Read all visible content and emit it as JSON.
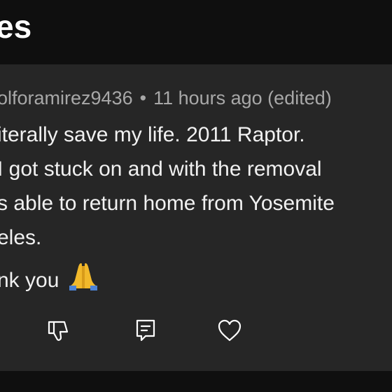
{
  "header": {
    "title": "es"
  },
  "comment": {
    "author": "olforamirez9436",
    "separator": "•",
    "time": "11 hours ago (edited)",
    "lines": [
      "iterally save my life. 2011 Raptor.",
      "I got stuck on and with the removal",
      "s able to return home from Yosemite",
      "eles.",
      "nk you"
    ],
    "emoji_icon": "folded-hands-emoji"
  },
  "actions": {
    "icons": [
      "thumbs-down-icon",
      "reply-icon",
      "heart-icon"
    ]
  },
  "colors": {
    "background": "#0f0f0f",
    "card": "#262626",
    "text": "#f1f1f1",
    "meta": "#a8a8a8"
  }
}
